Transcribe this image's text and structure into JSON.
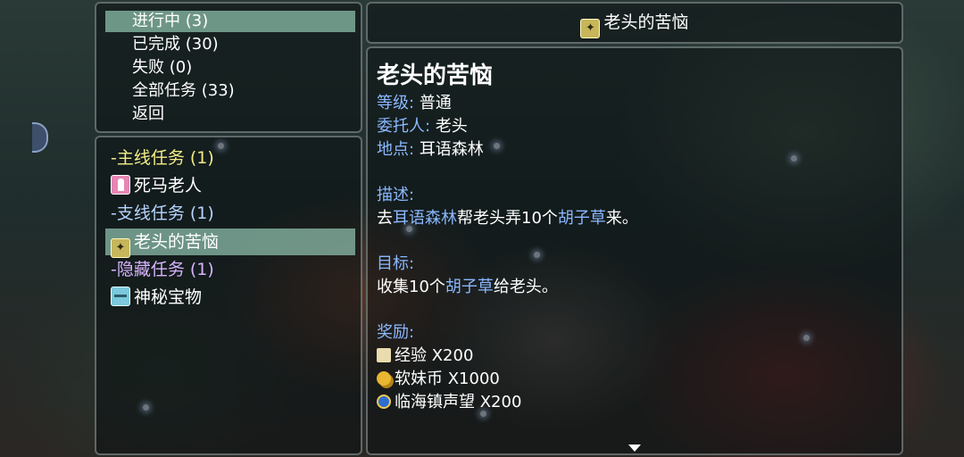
{
  "categories": [
    {
      "label": "进行中 (3)",
      "selected": true
    },
    {
      "label": "已完成 (30)",
      "selected": false
    },
    {
      "label": "失败 (0)",
      "selected": false
    },
    {
      "label": "全部任务 (33)",
      "selected": false
    },
    {
      "label": "返回",
      "selected": false
    }
  ],
  "quest_list": {
    "main_header": "-主线任务 (1)",
    "main_item": "死马老人",
    "side_header": "-支线任务 (1)",
    "side_item": "老头的苦恼",
    "hidden_header": "-隐藏任务 (1)",
    "hidden_item": "神秘宝物"
  },
  "title_bar": {
    "title": "老头的苦恼"
  },
  "detail": {
    "title": "老头的苦恼",
    "level_label": "等级:",
    "level_value": "普通",
    "client_label": "委托人:",
    "client_value": "老头",
    "location_label": "地点:",
    "location_value": "耳语森林",
    "description_label": "描述:",
    "description_parts": [
      "去",
      "耳语森林",
      "帮老头弄10个",
      "胡子草",
      "来。"
    ],
    "goal_label": "目标:",
    "goal_parts": [
      "收集10个",
      "胡子草",
      "给老头。"
    ],
    "reward_label": "奖励:",
    "rewards": [
      {
        "icon": "exp-scroll-icon",
        "text": "经验 X200"
      },
      {
        "icon": "coin-icon",
        "text": "软妹币 X1000"
      },
      {
        "icon": "reputation-icon",
        "text": "临海镇声望 X200"
      }
    ]
  },
  "colors": {
    "highlight_text": "#8ab8ff",
    "selection_bg": "#8cbeaa",
    "main_header": "#f2ec88",
    "hidden_header": "#d7b4ff"
  }
}
